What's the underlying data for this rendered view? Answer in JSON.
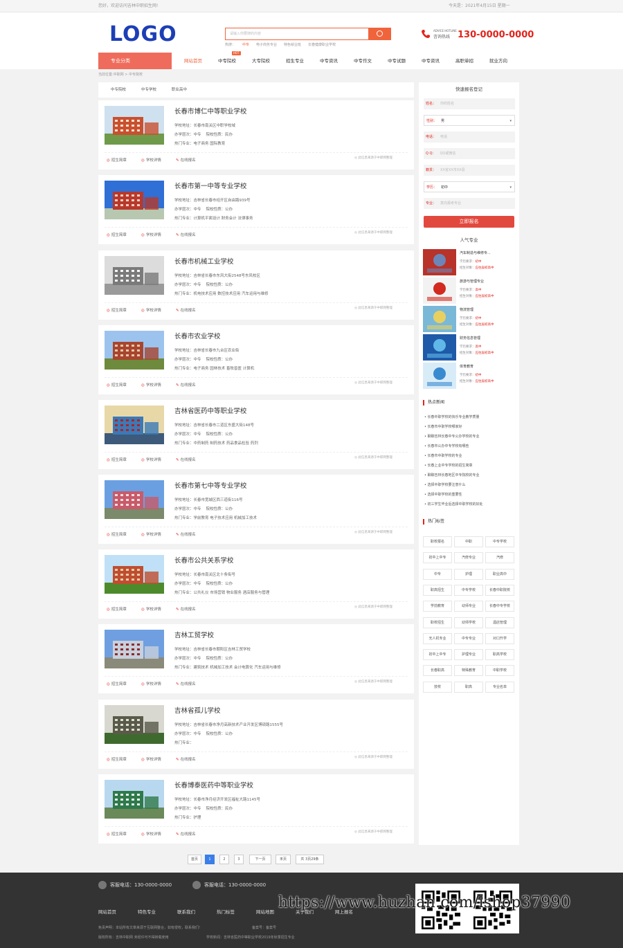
{
  "topbar": {
    "welcome": "您好，欢迎访问吉林中职招生网!",
    "date": "今天是：2021年4月15日 星期一"
  },
  "header": {
    "logo": "LOGO",
    "search_placeholder": "请输入你要搜的内容",
    "hot_label": "热搜：",
    "hot_words": [
      "中专",
      "电子商务专业",
      "特色就业班",
      "长春健康职业学校"
    ],
    "phone_small": "ADVICE HOTLINE",
    "phone_label": "咨询热线",
    "phone_number": "130-0000-0000"
  },
  "nav": {
    "category": "专业分类",
    "items": [
      "网站首页",
      "中专院校",
      "大专院校",
      "招生专业",
      "中专资讯",
      "中专作文",
      "中专试题",
      "中专资讯",
      "高职单招",
      "就业方向"
    ],
    "badge": "HOT"
  },
  "breadcrumb": "当前位置:中职网 > 中专院校",
  "filter": [
    "中专院校",
    "中专学校",
    "职业高中"
  ],
  "labels": {
    "address": "学校地址：",
    "level": "办学层次：",
    "nature": "院校性质：",
    "major": "热门专业：",
    "brochure": "招生简章",
    "review": "学校详情",
    "apply": "在线报名",
    "note": "此信息来源于中职网整理"
  },
  "schools": [
    {
      "name": "长春市博仁中等职业学校",
      "address": "长春市南关区中职学校域",
      "level": "中专",
      "nature": "民办",
      "major": "电子商务 国际教育"
    },
    {
      "name": "长春市第一中等专业学校",
      "address": "吉林省长春市经开区自由路939号",
      "level": "中专",
      "nature": "公办",
      "major": "计算机平面设计 财务会计 法律事务"
    },
    {
      "name": "长春市机械工业学校",
      "address": "吉林省长春市东风大街2548号东风校区",
      "level": "中专",
      "nature": "公办",
      "major": "机电技术应用 数控技术应用 汽车运用与维修"
    },
    {
      "name": "长春市农业学校",
      "address": "吉林省长春市九台区农业街",
      "level": "中专",
      "nature": "公办",
      "major": "电子商务 园林技术 畜牧兽医 计算机"
    },
    {
      "name": "吉林省医药中等职业学校",
      "address": "吉林省长春市二道区东盛大街148号",
      "level": "中专",
      "nature": "公办",
      "major": "中药制药 制药技术 药品食品检验 药剂"
    },
    {
      "name": "长春市第七中等专业学校",
      "address": "长春市宽城区西三道街116号",
      "level": "中专",
      "nature": "公办",
      "major": "学前教育 电子技术应用 机械加工技术"
    },
    {
      "name": "长春市公共关系学校",
      "address": "长春市南关区北十条街号",
      "level": "中专",
      "nature": "公办",
      "major": "公共礼仪 市场营销 物业服务 酒店服务与管理"
    },
    {
      "name": "吉林工贸学校",
      "address": "吉林省长春市朝阳区吉林工贸学校",
      "level": "中专",
      "nature": "公办",
      "major": "建筑技术 机械加工技术 会计电算化 汽车运用与维修"
    },
    {
      "name": "吉林省孤儿学校",
      "address": "吉林省长春市净月高新技术产业开发区博硕路1555号",
      "level": "中专",
      "nature": "公办",
      "major": ""
    },
    {
      "name": "长春博泰医药中等职业学校",
      "address": "长春市净月经济开发区福祉大路1145号",
      "level": "中专",
      "nature": "民办",
      "major": "护理"
    }
  ],
  "sidebar": {
    "form_title": "快速报名登记",
    "form": [
      {
        "label": "姓名：",
        "placeholder": "你的姓名"
      },
      {
        "label": "性别：",
        "value": "男"
      },
      {
        "label": "电话：",
        "placeholder": "电话"
      },
      {
        "label": "Q Q：",
        "placeholder": "QQ或微信"
      },
      {
        "label": "籍贯：",
        "placeholder": "XX省XX市XX县"
      },
      {
        "label": "学历：",
        "value": "初中"
      },
      {
        "label": "专业：",
        "placeholder": "意向报考专业"
      }
    ],
    "submit": "立即报名",
    "popular_title": "人气专业",
    "popular": [
      {
        "title": "汽车制造与维修专...",
        "l1": "学历要求：",
        "v1": "初中",
        "l2": "招生对象：",
        "v2": "应往届初高中"
      },
      {
        "title": "旅游与管理专业",
        "l1": "学历要求：",
        "v1": "高中",
        "l2": "招生对象：",
        "v2": "应往届初高中"
      },
      {
        "title": "物流管理",
        "l1": "学历要求：",
        "v1": "初中",
        "l2": "招生对象：",
        "v2": "应往届初高中"
      },
      {
        "title": "财务信息管理",
        "l1": "学历要求：",
        "v1": "高中",
        "l2": "招生对象：",
        "v2": "应往届初高中"
      },
      {
        "title": "体育教育",
        "l1": "学历要求：",
        "v1": "初中",
        "l2": "招生对象：",
        "v2": "应往届初高中"
      }
    ],
    "news_title": "热点新闻",
    "news": [
      "长春中职学校的快乐专业教学质量",
      "长春市中职学校哪家好",
      "聊聊吉林长春中专公办学校的专业",
      "长春市公办中专学校有哪些",
      "长春市中职学校的专业",
      "长春上业中专学校的招生简章",
      "聊聊吉林长春地区中专院校的专业",
      "选择中职学校要注意什么",
      "选择中职学校的重要性",
      "初三学生毕业后选择中职学校的好处"
    ],
    "tags_title": "热门标签",
    "tags": [
      "职校报名",
      "中职",
      "中专学校",
      "初中上中专",
      "汽修专业",
      "汽修",
      "中专",
      "护理",
      "职业高中",
      "职高招生",
      "中专学校",
      "长春中职院校",
      "学前教育",
      "幼师专业",
      "长春中专学校",
      "职校招生",
      "幼师学校",
      "酒店管理",
      "无人机专业",
      "中专专业",
      "对口升学",
      "初中上中专",
      "护理专业",
      "职高学校",
      "长春职高",
      "特殊教育",
      "中职学校",
      "技校",
      "职高",
      "专业名单"
    ]
  },
  "pager": [
    "首页",
    "1",
    "2",
    "3",
    "下一页",
    "末页",
    "共 3页29条"
  ],
  "footer": {
    "tel1": "客服电话：130-0000-0000",
    "tel2": "客服电话：130-0000-0000",
    "links": [
      "网站首页",
      "特色专业",
      "联系我们",
      "热门标签",
      "网站地图",
      "关于我们",
      "网上报名"
    ],
    "disclaimer": "免责声明：本站所有文章来源于互联网整合，如有侵权，联系我们!",
    "icp": "备案号：备案号",
    "copyright": "版权所有：吉林中职网 未经许可不得转载使用",
    "school_news": "学校新闻：吉林省医药中等职业学校2019年秋季招生专业"
  },
  "watermark": "https://www.huzhan.com/ishop37990"
}
